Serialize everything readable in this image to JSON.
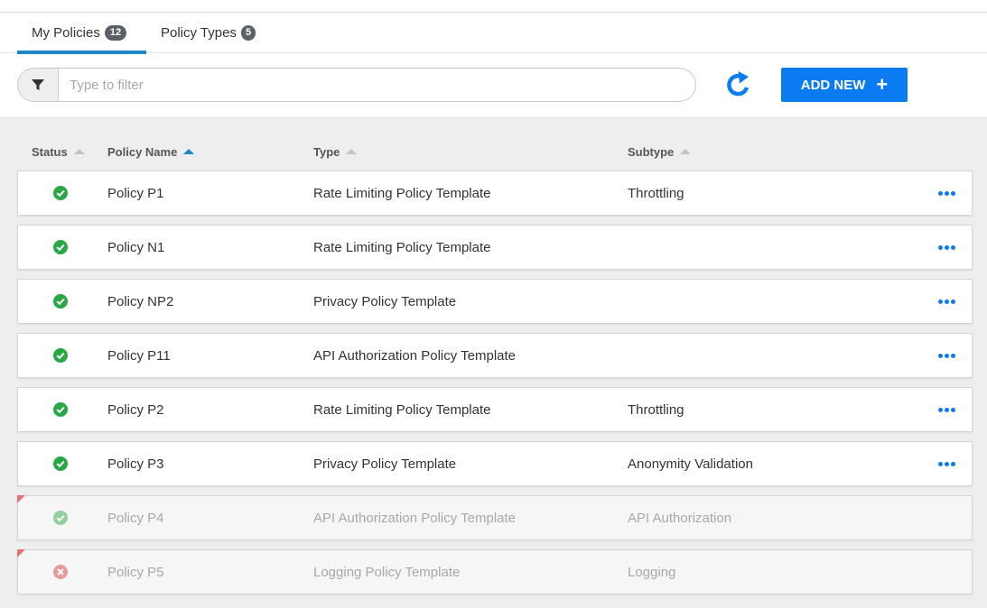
{
  "tabs": [
    {
      "label": "My Policies",
      "count": "12"
    },
    {
      "label": "Policy Types",
      "count": "5"
    }
  ],
  "filter": {
    "placeholder": "Type to filter",
    "value": ""
  },
  "actions": {
    "add_new_label": "ADD NEW",
    "add_icon": "plus-icon",
    "refresh_icon": "refresh-icon",
    "filter_icon": "filter-funnel-icon"
  },
  "table": {
    "headers": {
      "status": "Status",
      "name": "Policy Name",
      "type": "Type",
      "subtype": "Subtype"
    },
    "sorted_by": "Policy Name",
    "rows": [
      {
        "status": "active",
        "name": "Policy P1",
        "type": "Rate Limiting Policy Template",
        "subtype": "Throttling",
        "enabled": true
      },
      {
        "status": "active",
        "name": "Policy N1",
        "type": "Rate Limiting Policy Template",
        "subtype": "",
        "enabled": true
      },
      {
        "status": "active",
        "name": "Policy NP2",
        "type": "Privacy Policy Template",
        "subtype": "",
        "enabled": true
      },
      {
        "status": "active",
        "name": "Policy P11",
        "type": "API Authorization Policy Template",
        "subtype": "",
        "enabled": true
      },
      {
        "status": "active",
        "name": "Policy P2",
        "type": "Rate Limiting Policy Template",
        "subtype": "Throttling",
        "enabled": true
      },
      {
        "status": "active",
        "name": "Policy P3",
        "type": "Privacy Policy Template",
        "subtype": "Anonymity Validation",
        "enabled": true
      },
      {
        "status": "active",
        "name": "Policy P4",
        "type": "API Authorization Policy Template",
        "subtype": "API Authorization",
        "enabled": false
      },
      {
        "status": "error",
        "name": "Policy P5",
        "type": "Logging Policy Template",
        "subtype": "Logging",
        "enabled": false
      }
    ]
  },
  "colors": {
    "accent": "#0a7bf0",
    "tab_underline": "#1f86c5",
    "success": "#28a745",
    "success_muted": "#8fcf9d",
    "error_muted": "#e89a9a",
    "corner_flag": "#e57373"
  }
}
